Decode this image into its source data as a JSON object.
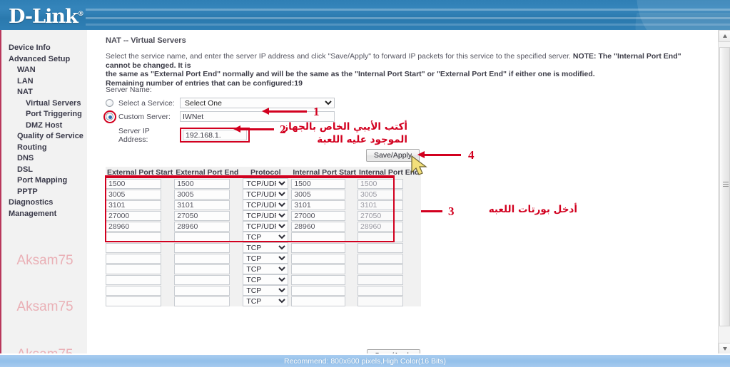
{
  "header": {
    "logo": "D-Link"
  },
  "sidebar": {
    "items": [
      {
        "label": "Device Info",
        "level": 0
      },
      {
        "label": "Advanced Setup",
        "level": 0
      },
      {
        "label": "WAN",
        "level": 1
      },
      {
        "label": "LAN",
        "level": 1
      },
      {
        "label": "NAT",
        "level": 1
      },
      {
        "label": "Virtual Servers",
        "level": 2
      },
      {
        "label": "Port Triggering",
        "level": 2
      },
      {
        "label": "DMZ Host",
        "level": 2
      },
      {
        "label": "Quality of Service",
        "level": 1
      },
      {
        "label": "Routing",
        "level": 1
      },
      {
        "label": "DNS",
        "level": 1
      },
      {
        "label": "DSL",
        "level": 1
      },
      {
        "label": "Port Mapping",
        "level": 1
      },
      {
        "label": "PPTP",
        "level": 1
      },
      {
        "label": "Diagnostics",
        "level": 0
      },
      {
        "label": "Management",
        "level": 0
      }
    ],
    "watermark": "Aksam75"
  },
  "main": {
    "title": "NAT -- Virtual Servers",
    "desc_line1_plain": "Select the service name, and enter the server IP address and click \"Save/Apply\" to forward IP packets for this service to the specified server. ",
    "desc_line1_bold": "NOTE: The \"Internal Port End\" cannot be changed. It is",
    "desc_line2": "the same as \"External Port End\" normally and will be the same as the \"Internal Port Start\" or \"External Port End\" if either one is modified.",
    "desc_line3": "Remaining number of entries that can be configured:19",
    "server_name_label": "Server Name:",
    "select_service_label": "Select a Service:",
    "select_service_value": "Select One",
    "custom_server_label": "Custom Server:",
    "custom_server_value": "IWNet",
    "server_ip_label": "Server IP Address:",
    "server_ip_value": "192.168.1.",
    "save_apply_top": "Save/Apply",
    "save_apply_bottom": "Save/Apply"
  },
  "annotations": {
    "n1": "1",
    "n2": "2",
    "n3": "3",
    "n4": "4",
    "ar2_line1": "أكتب الأيبي الخاص بالجهاز",
    "ar2_line2": "الموجود عليه اللعبة",
    "ar3": "أدخل بورتات اللعبه",
    "color": "#d2001f"
  },
  "table": {
    "headers": [
      "External Port Start",
      "External Port End",
      "Protocol",
      "Internal Port Start",
      "Internal Port End"
    ],
    "rows": [
      {
        "eps": "1500",
        "epe": "1500",
        "proto": "TCP/UDP",
        "ips": "1500",
        "ipe": "1500",
        "filled": true
      },
      {
        "eps": "3005",
        "epe": "3005",
        "proto": "TCP/UDP",
        "ips": "3005",
        "ipe": "3005",
        "filled": true
      },
      {
        "eps": "3101",
        "epe": "3101",
        "proto": "TCP/UDP",
        "ips": "3101",
        "ipe": "3101",
        "filled": true
      },
      {
        "eps": "27000",
        "epe": "27050",
        "proto": "TCP/UDP",
        "ips": "27000",
        "ipe": "27050",
        "filled": true
      },
      {
        "eps": "28960",
        "epe": "28960",
        "proto": "TCP/UDP",
        "ips": "28960",
        "ipe": "28960",
        "filled": true
      },
      {
        "eps": "",
        "epe": "",
        "proto": "TCP",
        "ips": "",
        "ipe": "",
        "filled": false
      },
      {
        "eps": "",
        "epe": "",
        "proto": "TCP",
        "ips": "",
        "ipe": "",
        "filled": false
      },
      {
        "eps": "",
        "epe": "",
        "proto": "TCP",
        "ips": "",
        "ipe": "",
        "filled": false
      },
      {
        "eps": "",
        "epe": "",
        "proto": "TCP",
        "ips": "",
        "ipe": "",
        "filled": false
      },
      {
        "eps": "",
        "epe": "",
        "proto": "TCP",
        "ips": "",
        "ipe": "",
        "filled": false
      },
      {
        "eps": "",
        "epe": "",
        "proto": "TCP",
        "ips": "",
        "ipe": "",
        "filled": false
      },
      {
        "eps": "",
        "epe": "",
        "proto": "TCP",
        "ips": "",
        "ipe": "",
        "filled": false
      }
    ]
  },
  "statusbar": {
    "text": "Recommend: 800x600 pixels,High Color(16 Bits)"
  },
  "scrollbar": {
    "up": "scroll-up",
    "down": "scroll-down"
  }
}
